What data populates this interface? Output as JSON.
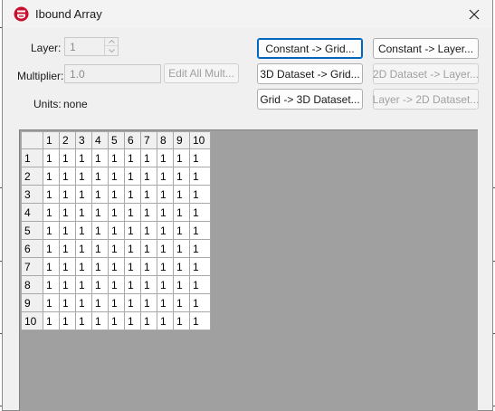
{
  "window": {
    "title": "Ibound Array"
  },
  "layer": {
    "label": "Layer:",
    "value": "1"
  },
  "multiplier": {
    "label": "Multiplier:",
    "value": "1.0"
  },
  "units": {
    "label": "Units:",
    "value": "none"
  },
  "buttons": {
    "edit_all_mult": "Edit All Mult...",
    "constant_to_grid": "Constant -> Grid...",
    "constant_to_layer": "Constant -> Layer...",
    "dataset3d_to_grid": "3D Dataset -> Grid...",
    "dataset2d_to_layer": "2D Dataset -> Layer...",
    "grid_to_dataset3d": "Grid -> 3D Dataset...",
    "layer_to_dataset2d": "Layer -> 2D Dataset..."
  },
  "grid": {
    "columns": [
      "1",
      "2",
      "3",
      "4",
      "5",
      "6",
      "7",
      "8",
      "9",
      "10"
    ],
    "rows": [
      "1",
      "2",
      "3",
      "4",
      "5",
      "6",
      "7",
      "8",
      "9",
      "10"
    ],
    "values": [
      [
        "1",
        "1",
        "1",
        "1",
        "1",
        "1",
        "1",
        "1",
        "1",
        "1"
      ],
      [
        "1",
        "1",
        "1",
        "1",
        "1",
        "1",
        "1",
        "1",
        "1",
        "1"
      ],
      [
        "1",
        "1",
        "1",
        "1",
        "1",
        "1",
        "1",
        "1",
        "1",
        "1"
      ],
      [
        "1",
        "1",
        "1",
        "1",
        "1",
        "1",
        "1",
        "1",
        "1",
        "1"
      ],
      [
        "1",
        "1",
        "1",
        "1",
        "1",
        "1",
        "1",
        "1",
        "1",
        "1"
      ],
      [
        "1",
        "1",
        "1",
        "1",
        "1",
        "1",
        "1",
        "1",
        "1",
        "1"
      ],
      [
        "1",
        "1",
        "1",
        "1",
        "1",
        "1",
        "1",
        "1",
        "1",
        "1"
      ],
      [
        "1",
        "1",
        "1",
        "1",
        "1",
        "1",
        "1",
        "1",
        "1",
        "1"
      ],
      [
        "1",
        "1",
        "1",
        "1",
        "1",
        "1",
        "1",
        "1",
        "1",
        "1"
      ],
      [
        "1",
        "1",
        "1",
        "1",
        "1",
        "1",
        "1",
        "1",
        "1",
        "1"
      ]
    ]
  },
  "colors": {
    "accent": "#0067c0",
    "icon_red": "#c8102e",
    "grid_background": "#a0a0a0"
  }
}
